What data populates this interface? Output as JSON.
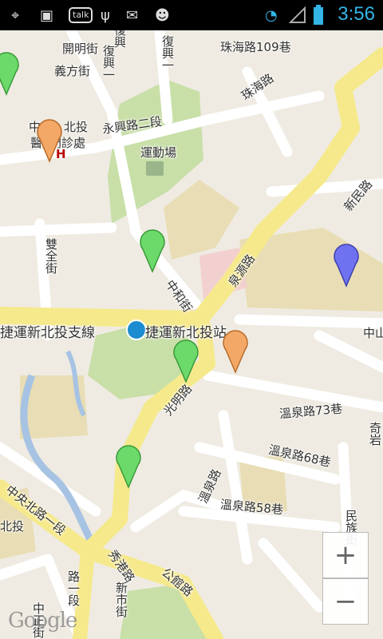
{
  "status_bar": {
    "icons": [
      "gps-icon",
      "image-icon",
      "talk-icon",
      "usb-icon",
      "gmail-icon",
      "android-icon",
      "wifi-icon",
      "signal-icon",
      "battery-icon"
    ],
    "talk_label": "talk",
    "time": "3:56",
    "accent_color": "#33b5e5"
  },
  "map": {
    "labels": {
      "zhuhai_109": "珠海路109巷",
      "kaiming": "開明街",
      "fuxing1": "復興一",
      "fuxing_top": "復興",
      "yifang": "義方街",
      "zhuhai": "珠海路",
      "xinbeitou": "北投",
      "zhongxin": "中心",
      "hospital": "醫",
      "clinic": "門診處",
      "yongxing2": "永興路二段",
      "playground": "運動場",
      "xinmin": "新民路",
      "shuangquan": "雙全街",
      "quanyuan": "泉源路",
      "zhonghe": "中和街",
      "mrt_line": "捷運新北投支線",
      "mrt_station": "捷運新北投站",
      "zhongshan": "中山",
      "guangming": "光明路",
      "wenquan73": "溫泉路73巷",
      "qiyan": "奇岩",
      "wenquan68": "溫泉路68巷",
      "wenquan": "溫泉路",
      "wenquan58": "溫泉路58巷",
      "minzu": "民族街",
      "zhongyangbei1": "中央北路一段",
      "beitou_left": "北投",
      "xiugang": "秀港路",
      "gongguan": "公館路",
      "xinshi": "新市街",
      "yiduan": "路一段",
      "zhongzheng": "中正街"
    },
    "hospital_marker": "H",
    "markers": [
      {
        "color": "green"
      },
      {
        "color": "orange"
      },
      {
        "color": "green"
      },
      {
        "color": "blue"
      },
      {
        "color": "green"
      },
      {
        "color": "orange"
      },
      {
        "color": "green"
      }
    ],
    "zoom_in_label": "+",
    "zoom_out_label": "−",
    "attribution": "Google"
  }
}
